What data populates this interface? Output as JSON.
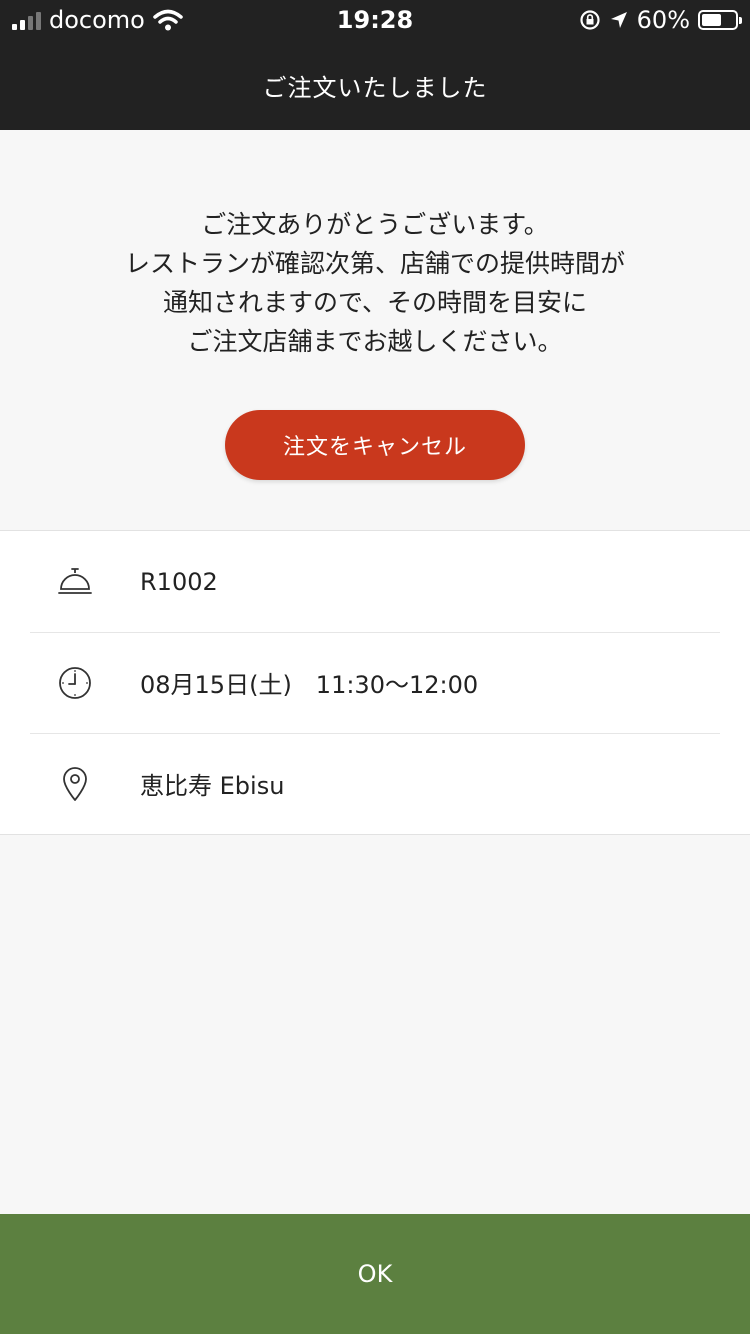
{
  "status_bar": {
    "carrier": "docomo",
    "time": "19:28",
    "battery_text": "60%",
    "battery_level": 0.6,
    "icons": [
      "signal-icon",
      "wifi-icon",
      "orientation-lock-icon",
      "location-arrow-icon",
      "battery-icon"
    ]
  },
  "header": {
    "title": "ご注文いたしました"
  },
  "message": {
    "lines": [
      "ご注文ありがとうございます。",
      "レストランが確認次第、店舗での提供時間が",
      "通知されますので、その時間を目安に",
      "ご注文店舗までお越しください。"
    ]
  },
  "cancel_button": {
    "label": "注文をキャンセル",
    "color": "#c9381d"
  },
  "order_info": {
    "order_number": "R1002",
    "pickup_time": "08月15日(土)　11:30〜12:00",
    "store": "恵比寿 Ebisu",
    "icons": [
      "service-bell-icon",
      "clock-icon",
      "map-pin-icon"
    ]
  },
  "ok_button": {
    "label": "OK",
    "color": "#5c8040"
  },
  "colors": {
    "header_bg": "#222222",
    "page_bg": "#f7f7f7"
  }
}
